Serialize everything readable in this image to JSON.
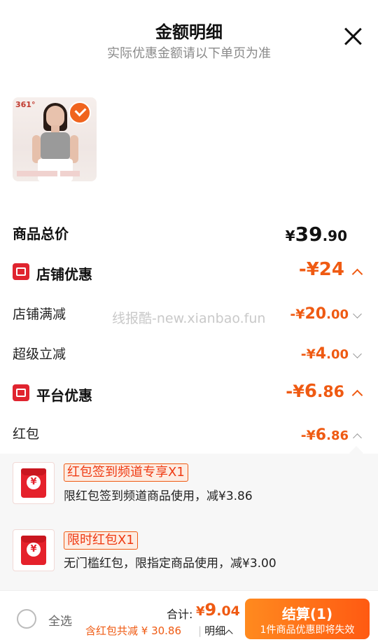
{
  "header": {
    "title": "金额明细",
    "subtitle": "实际优惠金额请以下单页为准"
  },
  "product": {
    "brand": "361°"
  },
  "total": {
    "label": "商品总价",
    "cur": "¥",
    "int": "39",
    "dec": ".90"
  },
  "store_discount": {
    "label": "店铺优惠",
    "amount": "-¥24",
    "items": [
      {
        "label": "店铺满减",
        "prefix": "-¥",
        "int": "20",
        "dec": ".00"
      },
      {
        "label": "超级立减",
        "prefix": "-¥",
        "int": "4",
        "dec": ".00"
      }
    ]
  },
  "watermark": "线报酷-new.xianbao.fun",
  "platform_discount": {
    "label": "平台优惠",
    "amount_prefix": "-¥",
    "amount_int": "6",
    "amount_dec": ".86",
    "items": [
      {
        "label": "红包",
        "prefix": "-¥",
        "int": "6",
        "dec": ".86"
      }
    ]
  },
  "red_packets": [
    {
      "tag": "红包签到频道专享X1",
      "desc": "限红包签到频道商品使用，减¥3.86"
    },
    {
      "tag": "限时红包X1",
      "desc": "无门槛红包，限指定商品使用，减¥3.00"
    }
  ],
  "footer": {
    "select_all": "全选",
    "sum_label": "合计:",
    "sum_cur": "¥",
    "sum_int": "9",
    "sum_dec": ".04",
    "note": "含红包共减 ¥ 30.86",
    "detail": "明细",
    "checkout_label": "结算(1)",
    "checkout_note": "1件商品优惠即将失效"
  },
  "colors": {
    "accent": "#ef5a12",
    "red": "#e0242f"
  }
}
